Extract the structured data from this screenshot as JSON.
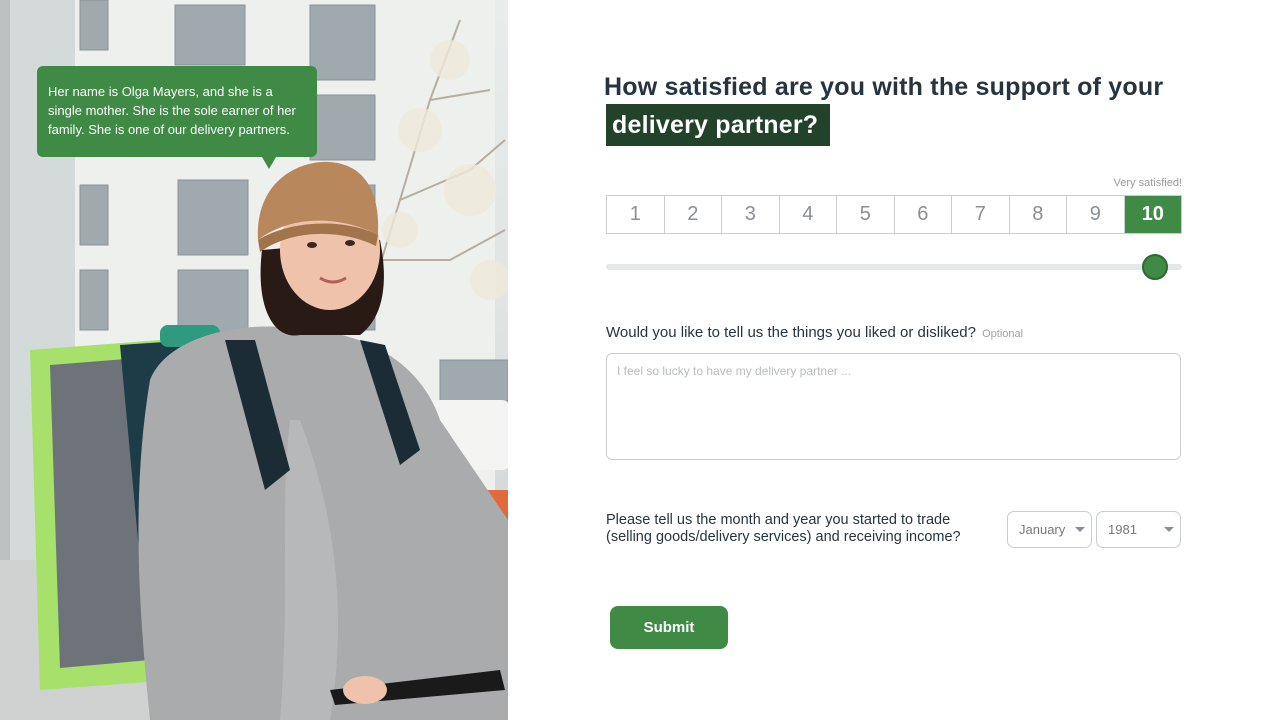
{
  "photo_caption": "Her name is Olga Mayers, and she is a single mother. She is the sole earner of her family. She is one of our delivery partners.",
  "question": {
    "title_line1": "How satisfied are you with the support of your",
    "title_highlight": "delivery partner?"
  },
  "rating": {
    "caption": "Very satisfied!",
    "options": [
      "1",
      "2",
      "3",
      "4",
      "5",
      "6",
      "7",
      "8",
      "9",
      "10"
    ],
    "selected": "10",
    "slider_value": 1.0
  },
  "feedback": {
    "label": "Would you like to tell us the things you liked or disliked?",
    "optional_tag": "Optional",
    "placeholder": "I feel so lucky to have my delivery partner ..."
  },
  "trade_start": {
    "label_line1": "Please tell us the month and year you started to trade",
    "label_line2": "(selling goods/delivery services) and receiving income?",
    "month": "January",
    "year": "1981"
  },
  "submit_label": "Submit",
  "colors": {
    "accent_green": "#3f8a44",
    "highlight_dark_green": "#22432a",
    "heading_text": "#26343f"
  }
}
